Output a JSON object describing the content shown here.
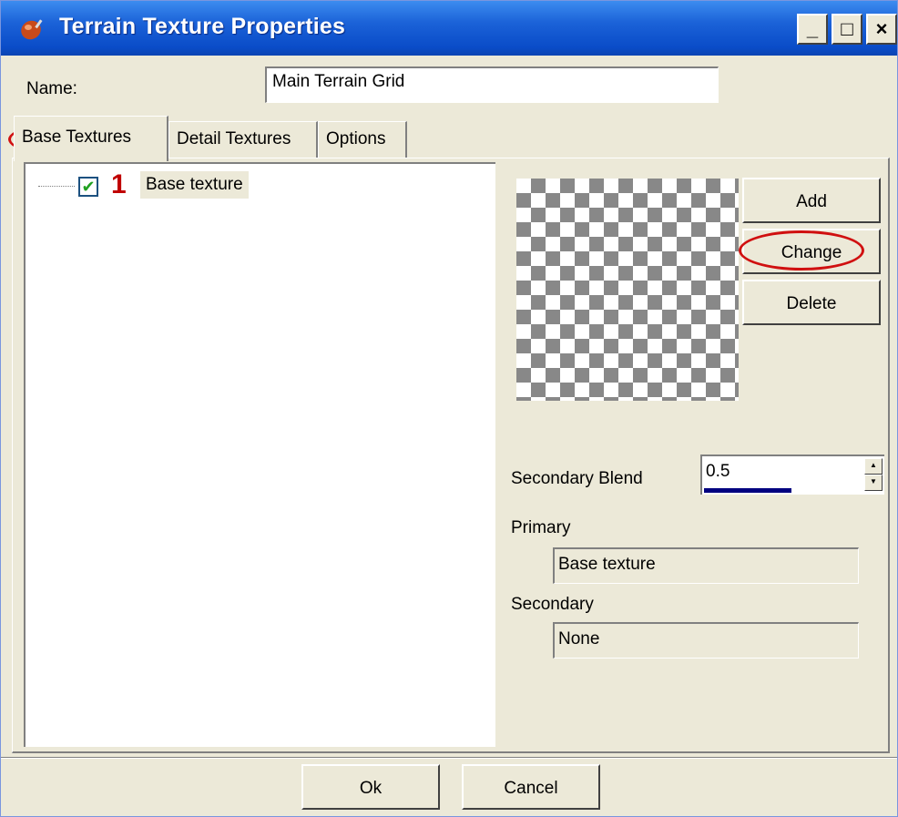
{
  "window": {
    "title": "Terrain Texture Properties",
    "controls": {
      "minimize": "_",
      "maximize": "□",
      "close": "×"
    }
  },
  "name_field": {
    "label": "Name:",
    "value": "Main Terrain Grid"
  },
  "tabs": [
    {
      "label": "Base Textures",
      "active": true
    },
    {
      "label": "Detail Textures",
      "active": false
    },
    {
      "label": "Options",
      "active": false
    }
  ],
  "texture_list": {
    "items": [
      {
        "index": "1",
        "label": "Base texture",
        "checked": true,
        "check_glyph": "✔"
      }
    ]
  },
  "buttons": {
    "add": "Add",
    "change": "Change",
    "delete": "Delete"
  },
  "secondary_blend": {
    "label": "Secondary Blend",
    "value": "0.5",
    "up_glyph": "▲",
    "down_glyph": "▼"
  },
  "primary": {
    "label": "Primary",
    "value": "Base texture"
  },
  "secondary": {
    "label": "Secondary",
    "value": "None"
  },
  "footer": {
    "ok": "Ok",
    "cancel": "Cancel"
  },
  "colors": {
    "titlebar": "#0a4cc8",
    "annotation": "#d01010",
    "face": "#ece9d8"
  },
  "icons": [
    "app-icon",
    "checkbox-checked-icon",
    "checkerboard-preview"
  ]
}
